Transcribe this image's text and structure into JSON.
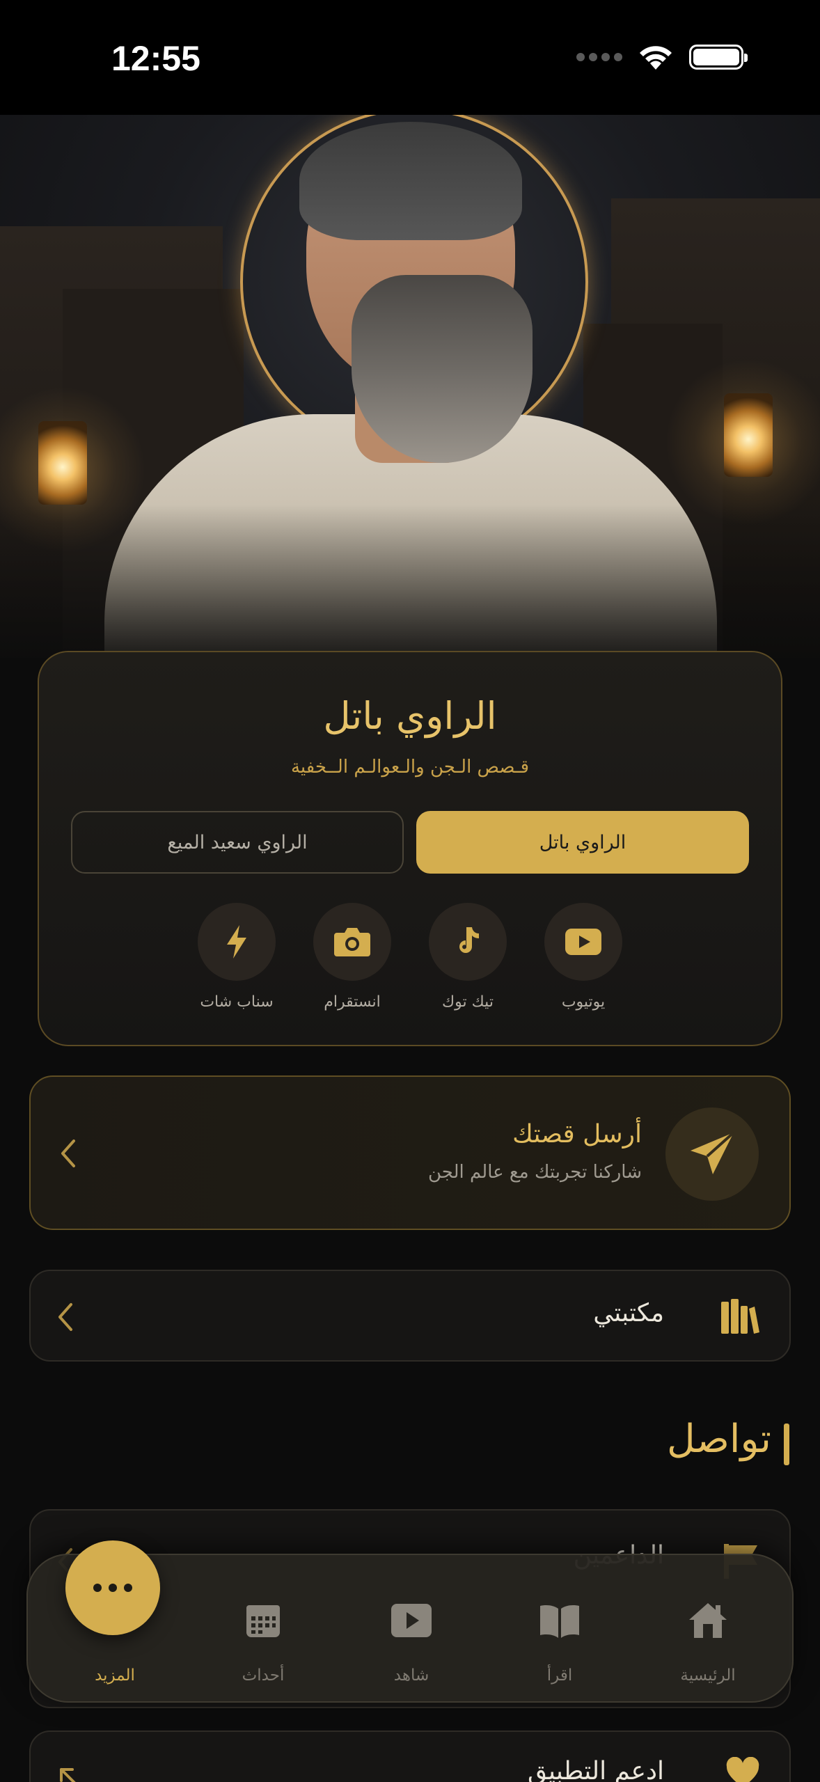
{
  "status_bar": {
    "time": "12:55"
  },
  "profile": {
    "name": "الراوي باتل",
    "subtitle": "قـصص الـجن والـعوالـم الــخفية",
    "narrator_tabs": [
      {
        "label": "الراوي باتل",
        "selected": true
      },
      {
        "label": "الراوي سعيد الميع",
        "selected": false
      }
    ],
    "socials": [
      {
        "label": "يوتيوب",
        "icon": "youtube-icon"
      },
      {
        "label": "تيك توك",
        "icon": "tiktok-icon"
      },
      {
        "label": "انستقرام",
        "icon": "instagram-icon"
      },
      {
        "label": "سناب شات",
        "icon": "snapchat-icon"
      }
    ]
  },
  "send_story": {
    "title": "أرسل قصتك",
    "subtitle": "شاركنا تجربتك مع عالم الجن",
    "icon": "paper-plane-icon"
  },
  "library": {
    "label": "مكتبتي",
    "icon": "books-icon"
  },
  "contact_section": {
    "title": "تواصل",
    "rows": [
      {
        "label": "الداعمين",
        "icon": "flag-icon"
      },
      {
        "label": "ادعم التطبيق",
        "icon": "heart-icon"
      }
    ]
  },
  "bottom_nav": {
    "items": [
      {
        "label": "الرئيسية",
        "icon": "home-icon"
      },
      {
        "label": "اقرأ",
        "icon": "book-open-icon"
      },
      {
        "label": "شاهد",
        "icon": "play-icon"
      },
      {
        "label": "أحداث",
        "icon": "calendar-icon"
      },
      {
        "label": "المزيد",
        "icon": "more-icon",
        "active": true
      }
    ]
  },
  "colors": {
    "accent": "#d4ae4f",
    "background": "#0c0c0c",
    "card": "#161514",
    "muted_text": "#7f7a71"
  }
}
